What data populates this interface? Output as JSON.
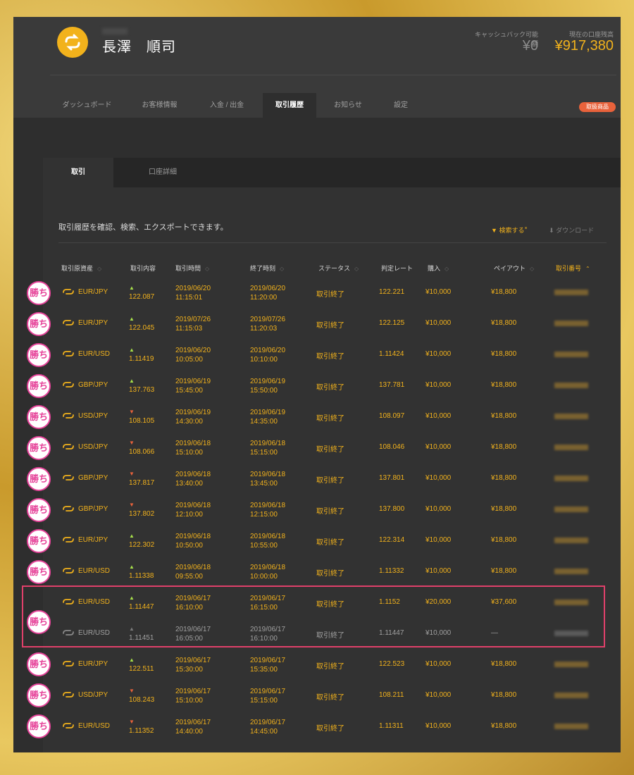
{
  "header": {
    "user_name": "長澤　順司",
    "cashback_label": "キャッシュバック可能額",
    "cashback_value": "¥0",
    "balance_label": "現在の口座残高",
    "balance_value": "¥917,380"
  },
  "nav": {
    "tabs": [
      "ダッシュボード",
      "お客様情報",
      "入金 / 出金",
      "取引履歴",
      "お知らせ",
      "設定"
    ],
    "active": "取引履歴",
    "pill": "取扱商品"
  },
  "subtabs": {
    "trade": "取引",
    "account_detail": "口座詳細"
  },
  "toolbar": {
    "description": "取引履歴を確認、検索、エクスポートできます。",
    "search": "検索する",
    "download": "ダウンロード"
  },
  "table": {
    "headers": [
      "取引原資産",
      "取引内容",
      "取引時間",
      "終了時刻",
      "ステータス",
      "判定レート",
      "購入",
      "ペイアウト",
      "取引番号"
    ],
    "rows": [
      {
        "asset": "EUR/JPY",
        "dir": "up",
        "rate": "122.087",
        "start_d": "2019/06/20",
        "start_t": "11:15:01",
        "end_d": "2019/06/20",
        "end_t": "11:20:00",
        "status": "取引終了",
        "judge": "122.221",
        "buy": "¥10,000",
        "payout": "¥18,800"
      },
      {
        "asset": "EUR/JPY",
        "dir": "up",
        "rate": "122.045",
        "start_d": "2019/07/26",
        "start_t": "11:15:03",
        "end_d": "2019/07/26",
        "end_t": "11:20:03",
        "status": "取引終了",
        "judge": "122.125",
        "buy": "¥10,000",
        "payout": "¥18,800"
      },
      {
        "asset": "EUR/USD",
        "dir": "up",
        "rate": "1.11419",
        "start_d": "2019/06/20",
        "start_t": "10:05:00",
        "end_d": "2019/06/20",
        "end_t": "10:10:00",
        "status": "取引終了",
        "judge": "1.11424",
        "buy": "¥10,000",
        "payout": "¥18,800"
      },
      {
        "asset": "GBP/JPY",
        "dir": "up",
        "rate": "137.763",
        "start_d": "2019/06/19",
        "start_t": "15:45:00",
        "end_d": "2019/06/19",
        "end_t": "15:50:00",
        "status": "取引終了",
        "judge": "137.781",
        "buy": "¥10,000",
        "payout": "¥18,800"
      },
      {
        "asset": "USD/JPY",
        "dir": "down",
        "rate": "108.105",
        "start_d": "2019/06/19",
        "start_t": "14:30:00",
        "end_d": "2019/06/19",
        "end_t": "14:35:00",
        "status": "取引終了",
        "judge": "108.097",
        "buy": "¥10,000",
        "payout": "¥18,800"
      },
      {
        "asset": "USD/JPY",
        "dir": "down",
        "rate": "108.066",
        "start_d": "2019/06/18",
        "start_t": "15:10:00",
        "end_d": "2019/06/18",
        "end_t": "15:15:00",
        "status": "取引終了",
        "judge": "108.046",
        "buy": "¥10,000",
        "payout": "¥18,800"
      },
      {
        "asset": "GBP/JPY",
        "dir": "down",
        "rate": "137.817",
        "start_d": "2019/06/18",
        "start_t": "13:40:00",
        "end_d": "2019/06/18",
        "end_t": "13:45:00",
        "status": "取引終了",
        "judge": "137.801",
        "buy": "¥10,000",
        "payout": "¥18,800"
      },
      {
        "asset": "GBP/JPY",
        "dir": "down",
        "rate": "137.802",
        "start_d": "2019/06/18",
        "start_t": "12:10:00",
        "end_d": "2019/06/18",
        "end_t": "12:15:00",
        "status": "取引終了",
        "judge": "137.800",
        "buy": "¥10,000",
        "payout": "¥18,800"
      },
      {
        "asset": "EUR/JPY",
        "dir": "up",
        "rate": "122.302",
        "start_d": "2019/06/18",
        "start_t": "10:50:00",
        "end_d": "2019/06/18",
        "end_t": "10:55:00",
        "status": "取引終了",
        "judge": "122.314",
        "buy": "¥10,000",
        "payout": "¥18,800"
      },
      {
        "asset": "EUR/USD",
        "dir": "up",
        "rate": "1.11338",
        "start_d": "2019/06/18",
        "start_t": "09:55:00",
        "end_d": "2019/06/18",
        "end_t": "10:00:00",
        "status": "取引終了",
        "judge": "1.11332",
        "buy": "¥10,000",
        "payout": "¥18,800"
      },
      {
        "asset": "EUR/USD",
        "dir": "up",
        "rate": "1.11447",
        "start_d": "2019/06/17",
        "start_t": "16:10:00",
        "end_d": "2019/06/17",
        "end_t": "16:15:00",
        "status": "取引終了",
        "judge": "1.1152",
        "buy": "¥20,000",
        "payout": "¥37,600"
      },
      {
        "asset": "EUR/USD",
        "dir": "up",
        "rate": "1.11451",
        "start_d": "2019/06/17",
        "start_t": "16:05:00",
        "end_d": "2019/06/17",
        "end_t": "16:10:00",
        "status": "取引終了",
        "judge": "1.11447",
        "buy": "¥10,000",
        "payout": "—",
        "grey": true
      },
      {
        "asset": "EUR/JPY",
        "dir": "up",
        "rate": "122.511",
        "start_d": "2019/06/17",
        "start_t": "15:30:00",
        "end_d": "2019/06/17",
        "end_t": "15:35:00",
        "status": "取引終了",
        "judge": "122.523",
        "buy": "¥10,000",
        "payout": "¥18,800"
      },
      {
        "asset": "USD/JPY",
        "dir": "down",
        "rate": "108.243",
        "start_d": "2019/06/17",
        "start_t": "15:10:00",
        "end_d": "2019/06/17",
        "end_t": "15:15:00",
        "status": "取引終了",
        "judge": "108.211",
        "buy": "¥10,000",
        "payout": "¥18,800"
      },
      {
        "asset": "EUR/USD",
        "dir": "down",
        "rate": "1.11352",
        "start_d": "2019/06/17",
        "start_t": "14:40:00",
        "end_d": "2019/06/17",
        "end_t": "14:45:00",
        "status": "取引終了",
        "judge": "1.11311",
        "buy": "¥10,000",
        "payout": "¥18,800"
      }
    ]
  },
  "badges": {
    "label": "勝ち",
    "count": 14
  },
  "colors": {
    "accent": "#f2b21c",
    "up": "#a8e04a",
    "down": "#e8623b",
    "badge": "#e6449a",
    "highlight": "#e0406a"
  }
}
